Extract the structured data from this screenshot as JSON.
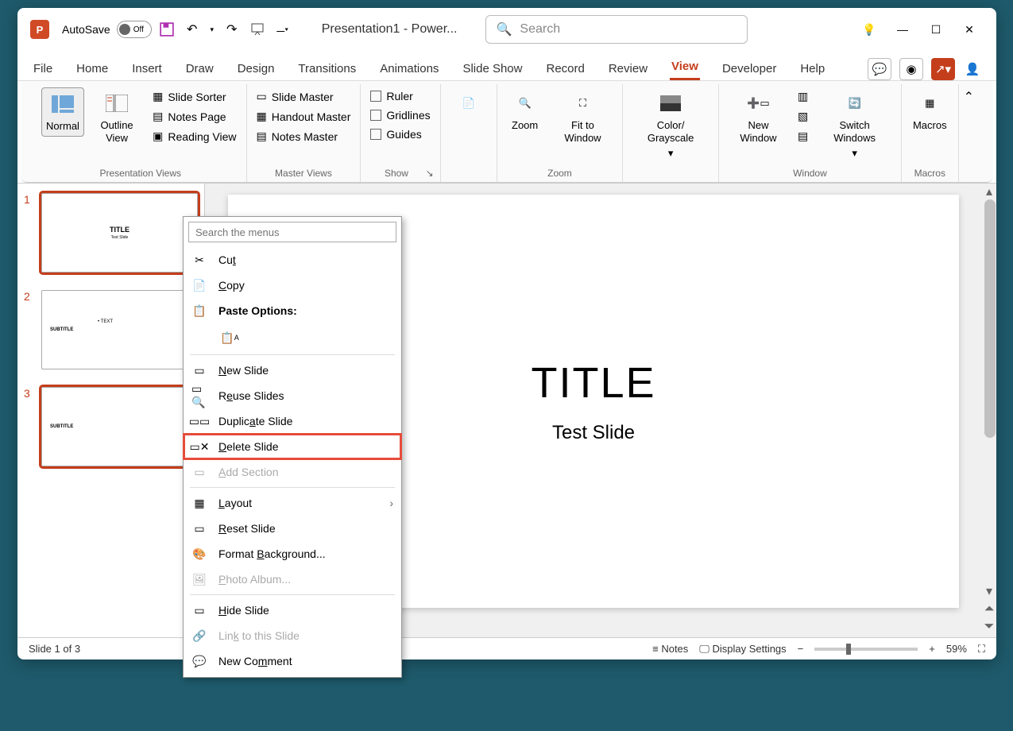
{
  "titlebar": {
    "autosave_label": "AutoSave",
    "autosave_state": "Off",
    "doc_title": "Presentation1  -  Power...",
    "search_placeholder": "Search"
  },
  "tabs": [
    "File",
    "Home",
    "Insert",
    "Draw",
    "Design",
    "Transitions",
    "Animations",
    "Slide Show",
    "Record",
    "Review",
    "View",
    "Developer",
    "Help"
  ],
  "active_tab": "View",
  "ribbon": {
    "groups": {
      "presentation_views": {
        "label": "Presentation Views",
        "normal": "Normal",
        "outline": "Outline View",
        "slide_sorter": "Slide Sorter",
        "notes_page": "Notes Page",
        "reading_view": "Reading View"
      },
      "master_views": {
        "label": "Master Views",
        "slide_master": "Slide Master",
        "handout_master": "Handout Master",
        "notes_master": "Notes Master"
      },
      "show": {
        "label": "Show",
        "ruler": "Ruler",
        "gridlines": "Gridlines",
        "guides": "Guides"
      },
      "notes": "Notes",
      "zoom": {
        "label": "Zoom",
        "zoom": "Zoom",
        "fit": "Fit to Window"
      },
      "color": {
        "label": "Color/ Grayscale"
      },
      "window": {
        "label": "Window",
        "new_window": "New Window",
        "switch": "Switch Windows"
      },
      "macros": {
        "label": "Macros",
        "macros": "Macros"
      }
    }
  },
  "thumbs": [
    {
      "num": "1",
      "title": "TITLE",
      "sub": "Test Slide",
      "selected": true
    },
    {
      "num": "2",
      "subtitle": "SUBTITLE",
      "bullet": "• TEXT",
      "selected": false
    },
    {
      "num": "3",
      "subtitle": "SUBTITLE",
      "selected": true
    }
  ],
  "slide": {
    "title": "TITLE",
    "subtitle": "Test Slide"
  },
  "context_menu": {
    "search_placeholder": "Search the menus",
    "cut": "Cut",
    "copy": "Copy",
    "paste_options": "Paste Options:",
    "new_slide": "New Slide",
    "reuse": "Reuse Slides",
    "duplicate": "Duplicate Slide",
    "delete": "Delete Slide",
    "add_section": "Add Section",
    "layout": "Layout",
    "reset": "Reset Slide",
    "format_bg": "Format Background...",
    "photo_album": "Photo Album...",
    "hide": "Hide Slide",
    "link": "Link to this Slide",
    "new_comment": "New Comment"
  },
  "statusbar": {
    "slide_info": "Slide 1 of 3",
    "notes": "Notes",
    "display": "Display Settings",
    "zoom": "59%"
  }
}
